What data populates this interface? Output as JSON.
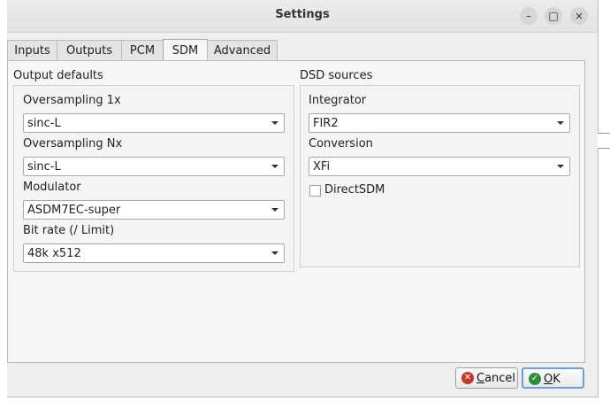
{
  "window": {
    "title": "Settings"
  },
  "window_controls": {
    "minimize": "–",
    "maximize": "□",
    "close": "×"
  },
  "tabs": [
    {
      "label": "Inputs",
      "active": false
    },
    {
      "label": "Outputs",
      "active": false
    },
    {
      "label": "PCM",
      "active": false
    },
    {
      "label": "SDM",
      "active": true
    },
    {
      "label": "Advanced",
      "active": false
    }
  ],
  "output_defaults": {
    "title": "Output defaults",
    "oversampling_1x": {
      "label": "Oversampling 1x",
      "value": "sinc-L"
    },
    "oversampling_nx": {
      "label": "Oversampling Nx",
      "value": "sinc-L"
    },
    "modulator": {
      "label": "Modulator",
      "value": "ASDM7EC-super"
    },
    "bit_rate": {
      "label": "Bit rate (/ Limit)",
      "value": "48k x512"
    }
  },
  "dsd_sources": {
    "title": "DSD sources",
    "integrator": {
      "label": "Integrator",
      "value": "FIR2"
    },
    "conversion": {
      "label": "Conversion",
      "value": "XFi"
    },
    "direct_sdm": {
      "label": "DirectSDM",
      "checked": false
    }
  },
  "buttons": {
    "cancel": {
      "mnemonic": "C",
      "rest": "ancel",
      "icon": "cancel-icon",
      "icon_color": "#c0392b"
    },
    "ok": {
      "mnemonic": "O",
      "rest": "K",
      "icon": "ok-icon",
      "icon_color": "#2e8b3a"
    }
  }
}
